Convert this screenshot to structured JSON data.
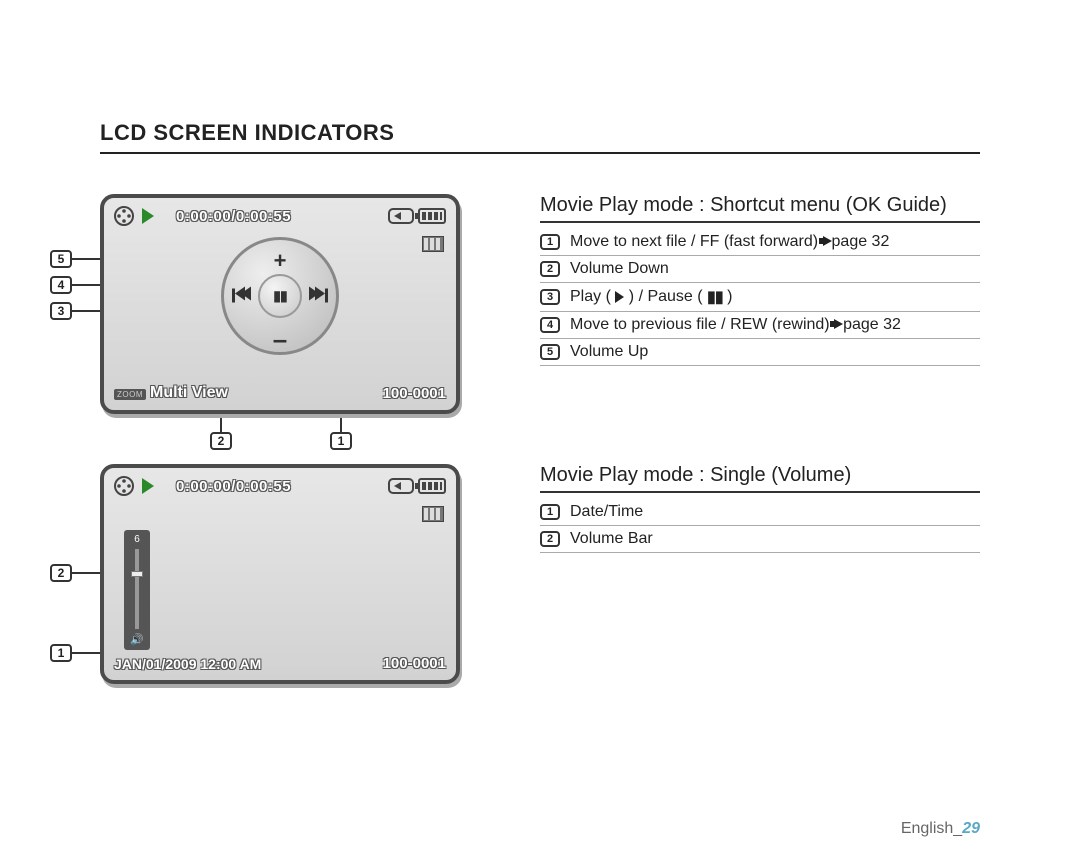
{
  "title": "LCD SCREEN INDICATORS",
  "lcd1": {
    "timecode": "0:00:00/0:00:55",
    "zoom": "ZOOM",
    "multiview": "Multi View",
    "file": "100-0001",
    "callouts": {
      "c1": "1",
      "c2": "2",
      "c3": "3",
      "c4": "4",
      "c5": "5"
    }
  },
  "guide1": {
    "heading": "Movie Play mode : Shortcut menu (OK Guide)",
    "items": [
      {
        "n": "1",
        "text": "Move to next file / FF (fast forward) ",
        "page": "page 32",
        "arrow": true
      },
      {
        "n": "2",
        "text": "Volume Down"
      },
      {
        "n": "3",
        "text": "Play ( ",
        "text2": " ) / Pause ( ",
        "text3": " )",
        "playpause": true
      },
      {
        "n": "4",
        "text": "Move to previous file / REW (rewind) ",
        "page": "page 32",
        "arrow": true
      },
      {
        "n": "5",
        "text": "Volume Up"
      }
    ]
  },
  "lcd2": {
    "timecode": "0:00:00/0:00:55",
    "volnum": "6",
    "date": "JAN/01/2009 12:00 AM",
    "file": "100-0001",
    "callouts": {
      "c1": "1",
      "c2": "2"
    }
  },
  "guide2": {
    "heading": "Movie Play mode : Single (Volume)",
    "items": [
      {
        "n": "1",
        "text": "Date/Time"
      },
      {
        "n": "2",
        "text": "Volume Bar"
      }
    ]
  },
  "footer": {
    "lang": "English",
    "sep": "_",
    "page": "29"
  }
}
